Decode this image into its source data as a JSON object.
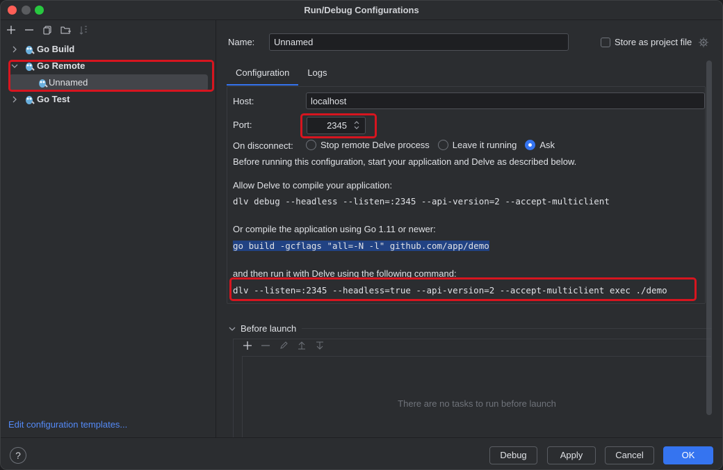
{
  "window": {
    "title": "Run/Debug Configurations"
  },
  "toolbar": {
    "add": "+",
    "remove": "−",
    "copy": "⧉",
    "folder": "🗀",
    "sort": "⇅"
  },
  "tree": {
    "items": [
      {
        "label": "Go Build",
        "expanded": false
      },
      {
        "label": "Go Remote",
        "expanded": true
      },
      {
        "label": "Unnamed",
        "selected": true
      },
      {
        "label": "Go Test",
        "expanded": false
      }
    ]
  },
  "left": {
    "edit_templates": "Edit configuration templates..."
  },
  "form": {
    "name_label": "Name:",
    "name_value": "Unnamed",
    "store_label": "Store as project file",
    "tabs": [
      "Configuration",
      "Logs"
    ],
    "host_label": "Host:",
    "host_value": "localhost",
    "port_label": "Port:",
    "port_value": "2345",
    "disconnect_label": "On disconnect:",
    "disconnect_options": [
      "Stop remote Delve process",
      "Leave it running",
      "Ask"
    ],
    "disconnect_selected": "Ask",
    "info": "Before running this configuration, start your application and Delve as described below.",
    "allow_label": "Allow Delve to compile your application:",
    "allow_cmd": "dlv debug --headless --listen=:2345 --api-version=2 --accept-multiclient",
    "or_label": "Or compile the application using Go 1.11 or newer:",
    "build_cmd": "go build -gcflags \"all=-N -l\" github.com/app/demo",
    "then_label": "and then run it with Delve using the following command:",
    "run_cmd": "dlv --listen=:2345 --headless=true --api-version=2 --accept-multiclient exec ./demo"
  },
  "before_launch": {
    "title": "Before launch",
    "empty": "There are no tasks to run before launch"
  },
  "footer": {
    "help": "?",
    "debug": "Debug",
    "apply": "Apply",
    "cancel": "Cancel",
    "ok": "OK"
  },
  "colors": {
    "accent": "#3574f0",
    "highlight": "#d7151f",
    "link": "#548af7"
  }
}
